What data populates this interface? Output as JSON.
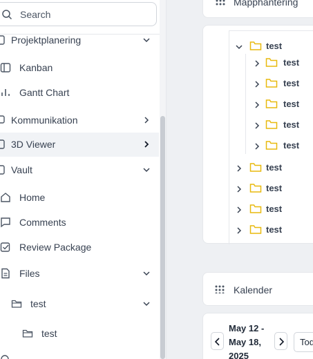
{
  "search": {
    "placeholder": "Search"
  },
  "sidebar": {
    "items": [
      {
        "label": "Projektplanering",
        "expanded": true,
        "icon": "project-icon"
      },
      {
        "label": "Kanban",
        "icon": "kanban-icon"
      },
      {
        "label": "Gantt Chart",
        "icon": "bar-chart-icon"
      },
      {
        "label": "Kommunikation",
        "expanded": false,
        "icon": "chat-icon"
      },
      {
        "label": "3D Viewer",
        "expanded": false,
        "active": true,
        "icon": "cube-icon"
      },
      {
        "label": "Vault",
        "expanded": true,
        "icon": "vault-icon"
      },
      {
        "label": "Home",
        "icon": "home-icon"
      },
      {
        "label": "Comments",
        "icon": "comment-icon"
      },
      {
        "label": "Review Package",
        "icon": "checkbox-icon"
      },
      {
        "label": "Files",
        "expanded": true,
        "icon": "file-icon"
      },
      {
        "label": "test",
        "expanded": true,
        "icon": "folder-icon"
      },
      {
        "label": "test",
        "icon": "folder-icon"
      }
    ]
  },
  "mapphantering": {
    "title": "Mapphantering",
    "root": {
      "label": "test",
      "expanded": true
    },
    "children": [
      "test",
      "test",
      "test",
      "test",
      "test"
    ],
    "siblings": [
      "test",
      "test",
      "test",
      "test"
    ]
  },
  "kalender": {
    "title": "Kalender",
    "date_range": "May 12 - May 18, 2025",
    "today_label": "Tod"
  },
  "colors": {
    "folder": "#e8b90d",
    "active_bg": "#f1f3f6",
    "border": "#e5e7eb"
  }
}
